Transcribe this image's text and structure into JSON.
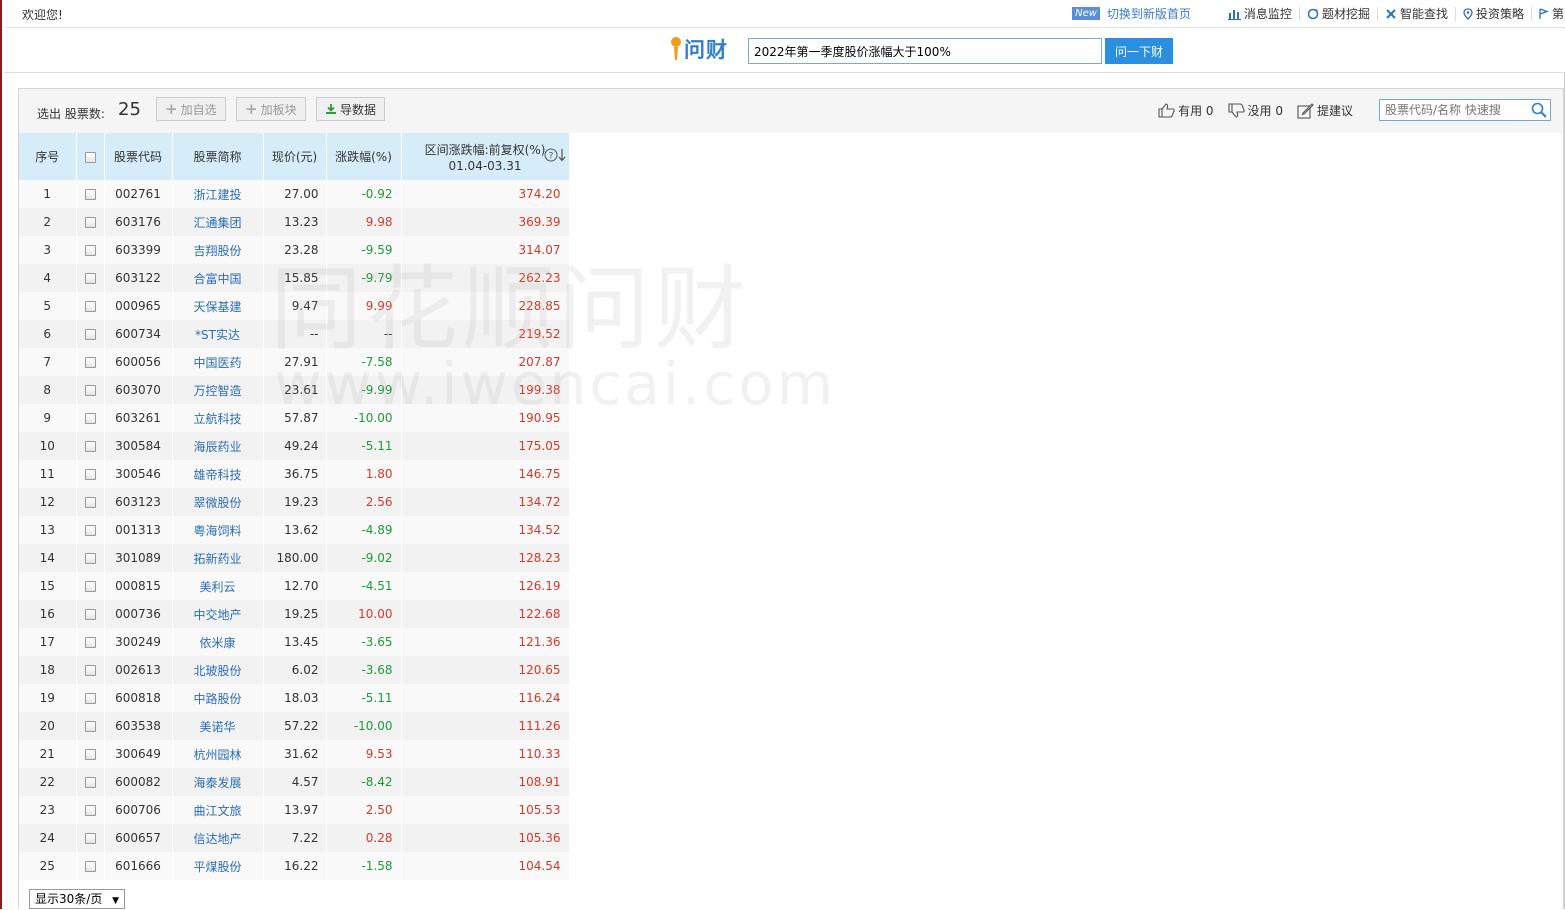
{
  "topbar": {
    "welcome": "欢迎您!",
    "new_badge": "New",
    "switch_label": "切换到新版首页",
    "links": [
      {
        "label": "消息监控",
        "icon": "chart-icon"
      },
      {
        "label": "题材挖掘",
        "icon": "refresh-icon"
      },
      {
        "label": "智能查找",
        "icon": "cross-icon"
      },
      {
        "label": "投资策略",
        "icon": "pin-icon"
      },
      {
        "label": "第",
        "icon": "flag-icon"
      }
    ]
  },
  "search": {
    "logo_text": "问财",
    "query": "2022年第一季度股价涨幅大于100%",
    "button_label": "问一下财"
  },
  "toolbar": {
    "count_label": "选出 股票数:",
    "count_value": "25",
    "add_watch_label": "加自选",
    "add_block_label": "加板块",
    "export_label": "导数据",
    "useful_label": "有用 0",
    "useless_label": "没用 0",
    "suggest_label": "提建议",
    "quick_search_placeholder": "股票代码/名称 快速搜"
  },
  "table": {
    "headers": {
      "index": "序号",
      "code": "股票代码",
      "name": "股票简称",
      "price": "现价(元)",
      "change": "涨跌幅(%)",
      "range_line1": "区间涨跌幅:前复权(%)",
      "range_line2": "01.04-03.31"
    },
    "rows": [
      {
        "idx": "1",
        "code": "002761",
        "name": "浙江建投",
        "price": "27.00",
        "chg": "-0.92",
        "rng": "374.20"
      },
      {
        "idx": "2",
        "code": "603176",
        "name": "汇通集团",
        "price": "13.23",
        "chg": "9.98",
        "rng": "369.39"
      },
      {
        "idx": "3",
        "code": "603399",
        "name": "吉翔股份",
        "price": "23.28",
        "chg": "-9.59",
        "rng": "314.07"
      },
      {
        "idx": "4",
        "code": "603122",
        "name": "合富中国",
        "price": "15.85",
        "chg": "-9.79",
        "rng": "262.23"
      },
      {
        "idx": "5",
        "code": "000965",
        "name": "天保基建",
        "price": "9.47",
        "chg": "9.99",
        "rng": "228.85"
      },
      {
        "idx": "6",
        "code": "600734",
        "name": "*ST实达",
        "price": "--",
        "chg": "--",
        "rng": "219.52"
      },
      {
        "idx": "7",
        "code": "600056",
        "name": "中国医药",
        "price": "27.91",
        "chg": "-7.58",
        "rng": "207.87"
      },
      {
        "idx": "8",
        "code": "603070",
        "name": "万控智造",
        "price": "23.61",
        "chg": "-9.99",
        "rng": "199.38"
      },
      {
        "idx": "9",
        "code": "603261",
        "name": "立航科技",
        "price": "57.87",
        "chg": "-10.00",
        "rng": "190.95"
      },
      {
        "idx": "10",
        "code": "300584",
        "name": "海辰药业",
        "price": "49.24",
        "chg": "-5.11",
        "rng": "175.05"
      },
      {
        "idx": "11",
        "code": "300546",
        "name": "雄帝科技",
        "price": "36.75",
        "chg": "1.80",
        "rng": "146.75"
      },
      {
        "idx": "12",
        "code": "603123",
        "name": "翠微股份",
        "price": "19.23",
        "chg": "2.56",
        "rng": "134.72"
      },
      {
        "idx": "13",
        "code": "001313",
        "name": "粤海饲料",
        "price": "13.62",
        "chg": "-4.89",
        "rng": "134.52"
      },
      {
        "idx": "14",
        "code": "301089",
        "name": "拓新药业",
        "price": "180.00",
        "chg": "-9.02",
        "rng": "128.23"
      },
      {
        "idx": "15",
        "code": "000815",
        "name": "美利云",
        "price": "12.70",
        "chg": "-4.51",
        "rng": "126.19"
      },
      {
        "idx": "16",
        "code": "000736",
        "name": "中交地产",
        "price": "19.25",
        "chg": "10.00",
        "rng": "122.68"
      },
      {
        "idx": "17",
        "code": "300249",
        "name": "依米康",
        "price": "13.45",
        "chg": "-3.65",
        "rng": "121.36"
      },
      {
        "idx": "18",
        "code": "002613",
        "name": "北玻股份",
        "price": "6.02",
        "chg": "-3.68",
        "rng": "120.65"
      },
      {
        "idx": "19",
        "code": "600818",
        "name": "中路股份",
        "price": "18.03",
        "chg": "-5.11",
        "rng": "116.24"
      },
      {
        "idx": "20",
        "code": "603538",
        "name": "美诺华",
        "price": "57.22",
        "chg": "-10.00",
        "rng": "111.26"
      },
      {
        "idx": "21",
        "code": "300649",
        "name": "杭州园林",
        "price": "31.62",
        "chg": "9.53",
        "rng": "110.33"
      },
      {
        "idx": "22",
        "code": "600082",
        "name": "海泰发展",
        "price": "4.57",
        "chg": "-8.42",
        "rng": "108.91"
      },
      {
        "idx": "23",
        "code": "600706",
        "name": "曲江文旅",
        "price": "13.97",
        "chg": "2.50",
        "rng": "105.53"
      },
      {
        "idx": "24",
        "code": "600657",
        "name": "信达地产",
        "price": "7.22",
        "chg": "0.28",
        "rng": "105.36"
      },
      {
        "idx": "25",
        "code": "601666",
        "name": "平煤股份",
        "price": "16.22",
        "chg": "-1.58",
        "rng": "104.54"
      }
    ]
  },
  "watermark": {
    "line1": "同花顺问财",
    "line2": "www.iwencai.com"
  },
  "pager": {
    "page_size_label": "显示30条/页"
  },
  "colors": {
    "up": "#d03a2a",
    "down": "#1a9b38",
    "link": "#2a6db5",
    "header_bg": "#d6edf9",
    "button_blue": "#2b8fe0"
  }
}
